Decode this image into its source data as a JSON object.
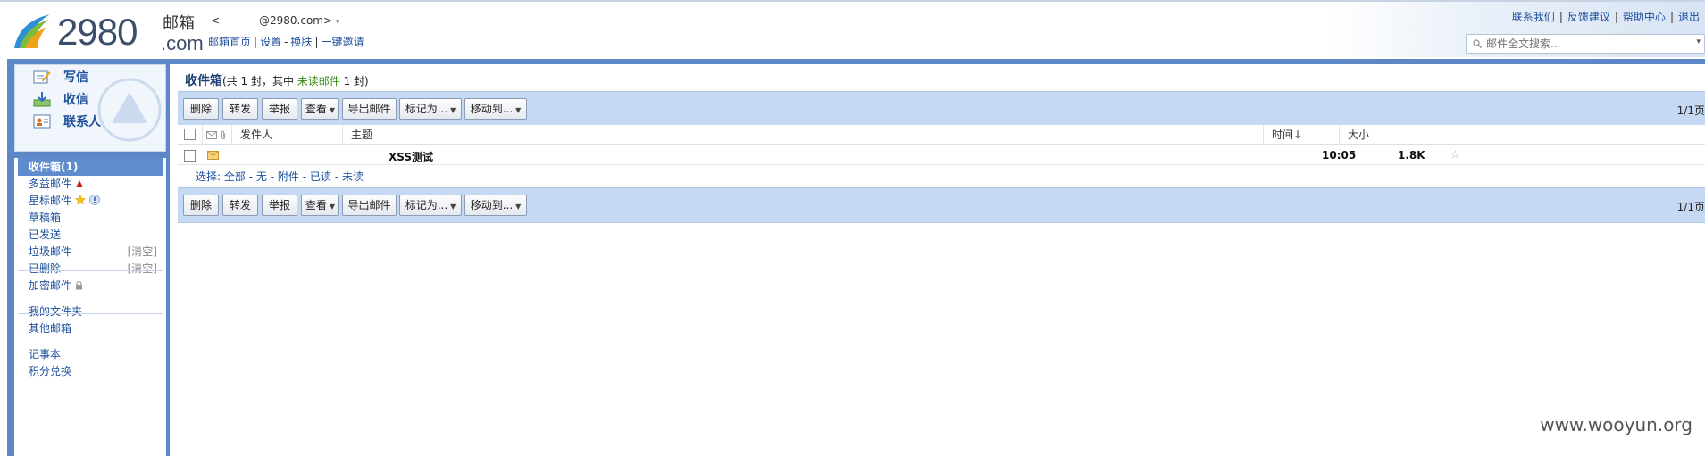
{
  "logo": {
    "number": "2980",
    "cn": "邮箱",
    "com": ".com"
  },
  "user": {
    "prefix": "<",
    "email": "@2980.com>",
    "dropdown_glyph": "▾"
  },
  "header_links": [
    "邮箱首页",
    "设置",
    "换肤",
    "一键邀请"
  ],
  "header_seps": [
    "|",
    "-",
    "|"
  ],
  "top_right_links": [
    "联系我们",
    "反馈建议",
    "帮助中心",
    "退出"
  ],
  "top_right_sep": "|",
  "search": {
    "placeholder": "邮件全文搜索...",
    "dropdown_glyph": "▾"
  },
  "sidebar": {
    "quick": [
      {
        "label": "写信",
        "icon": "compose-icon"
      },
      {
        "label": "收信",
        "icon": "receive-icon"
      },
      {
        "label": "联系人",
        "icon": "contacts-icon"
      }
    ],
    "folders": [
      {
        "label": "收件箱(1)",
        "active": true,
        "right": ""
      },
      {
        "label": "多益邮件",
        "badge": "red-badge-icon",
        "right": ""
      },
      {
        "label": "星标邮件",
        "badge": "star-icon",
        "right": ""
      },
      {
        "label": "草稿箱",
        "right": ""
      },
      {
        "label": "已发送",
        "right": ""
      },
      {
        "label": "垃圾邮件",
        "right": "[清空]"
      },
      {
        "label": "已删除",
        "right": "[清空]"
      },
      {
        "label": "加密邮件",
        "badge": "lock-icon",
        "right": ""
      }
    ],
    "group2": [
      "我的文件夹",
      "其他邮箱"
    ],
    "group3": [
      "记事本",
      "积分兑换"
    ]
  },
  "inbox": {
    "title": "收件箱",
    "summary_prefix": "(共 1 封，其中 ",
    "unread_label": "未读邮件",
    "summary_suffix": " 1 封)"
  },
  "toolbar": {
    "buttons": [
      "删除",
      "转发",
      "举报",
      "查看",
      "导出邮件",
      "标记为...",
      "移动到..."
    ],
    "pager": "1/1页"
  },
  "columns": {
    "sender": "发件人",
    "subject": "主题",
    "time": "时间↓",
    "size": "大小"
  },
  "rows": [
    {
      "sender": "",
      "subject": "XSS测试",
      "time": "10:05",
      "size": "1.8K",
      "star": "☆"
    }
  ],
  "select_line": {
    "label": "选择:",
    "options": [
      "全部",
      "无",
      "附件",
      "已读",
      "未读"
    ],
    "sep": "-"
  },
  "watermark": "www.wooyun.org",
  "colors": {
    "frame": "#5d88c8",
    "toolbar": "#c5d9f2",
    "link": "#1d4f9c",
    "unread": "#3a8a16",
    "active_folder": "#5f8bcf"
  }
}
